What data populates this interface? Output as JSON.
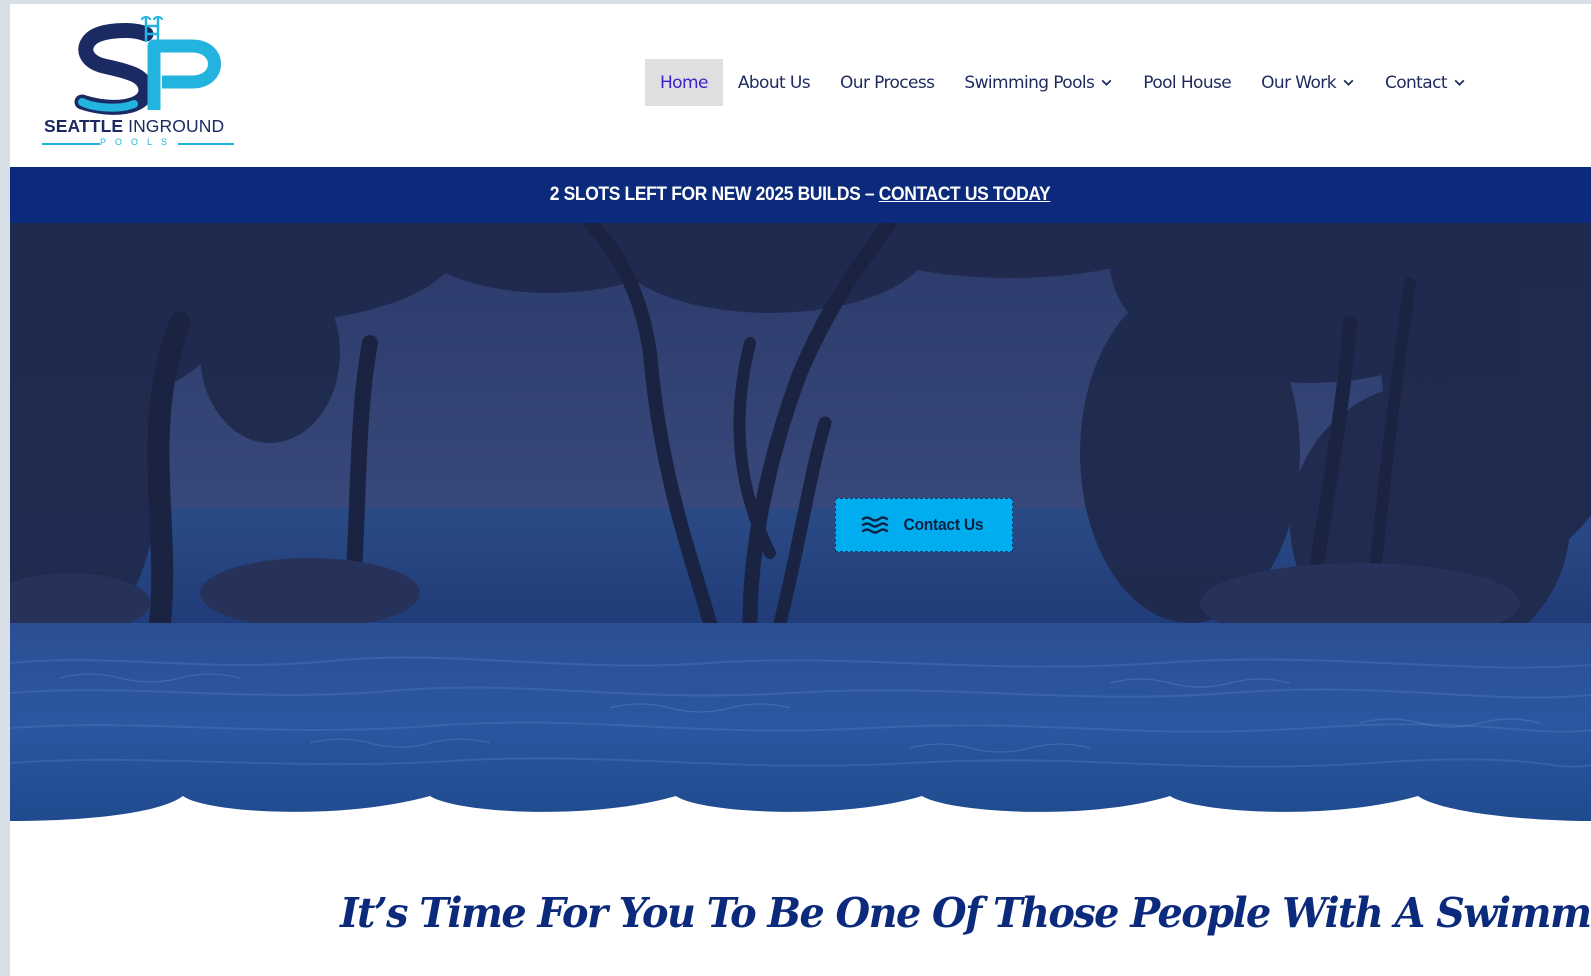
{
  "brand": {
    "logo_text_bold": "SEATTLE",
    "logo_text_regular": " INGROUND",
    "logo_sub": "POOLS",
    "logo_icon": "sp-monogram-pool-ladder-logo",
    "colors": {
      "navy": "#1b2a63",
      "cyan": "#22b4de"
    }
  },
  "nav": {
    "items": [
      {
        "label": "Home",
        "active": true,
        "has_dropdown": false
      },
      {
        "label": "About Us",
        "active": false,
        "has_dropdown": false
      },
      {
        "label": "Our Process",
        "active": false,
        "has_dropdown": false
      },
      {
        "label": "Swimming Pools",
        "active": false,
        "has_dropdown": true
      },
      {
        "label": "Pool House",
        "active": false,
        "has_dropdown": false
      },
      {
        "label": "Our Work",
        "active": false,
        "has_dropdown": true
      },
      {
        "label": "Contact",
        "active": false,
        "has_dropdown": true
      }
    ],
    "dropdown_icon": "chevron-down-icon",
    "colors": {
      "text": "#1e2a5e",
      "active_text": "#3a22c8",
      "active_bg": "#dfdfe1"
    }
  },
  "banner": {
    "text": "2 SLOTS LEFT FOR NEW 2025 BUILDS – ",
    "link_text": "CONTACT US TODAY",
    "background": "#0c2a7c"
  },
  "hero": {
    "image": "infinity-pool-with-trees-and-ocean",
    "cta": {
      "label": "Contact Us",
      "icon": "water-waves-icon",
      "background": "#00aeef"
    }
  },
  "main": {
    "heading": "It’s Time For You To Be One Of Those People With A Swimming Pool"
  }
}
